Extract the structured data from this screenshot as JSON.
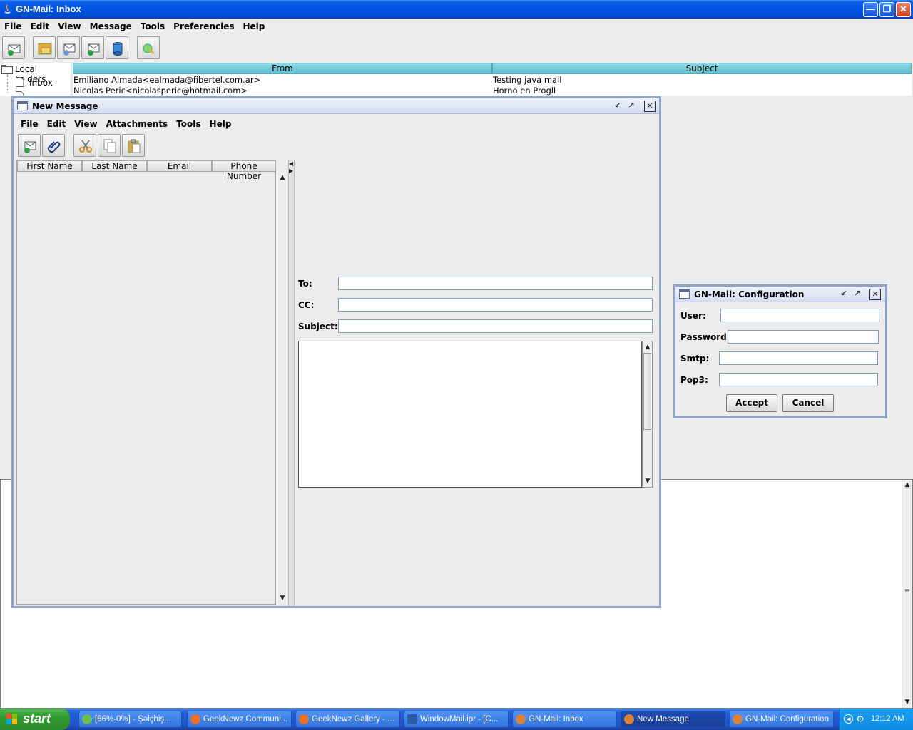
{
  "main_window": {
    "title": "GN-Mail: Inbox",
    "menu": [
      "File",
      "Edit",
      "View",
      "Message",
      "Tools",
      "Preferencies",
      "Help"
    ],
    "folder_tree": {
      "root": "Local Folders",
      "items": [
        "Inbox"
      ]
    },
    "mail_table": {
      "columns": [
        "From",
        "Subject"
      ],
      "rows": [
        {
          "from": "Emiliano Almada<ealmada@fibertel.com.ar>",
          "subject": "Testing java mail"
        },
        {
          "from": "Nicolas Peric<nicolasperic@hotmail.com>",
          "subject": "Horno en Progll"
        }
      ]
    }
  },
  "new_message": {
    "title": "New Message",
    "menu": [
      "File",
      "Edit",
      "View",
      "Attachments",
      "Tools",
      "Help"
    ],
    "contacts_columns": [
      "First Name",
      "Last Name",
      "Email",
      "Phone Number"
    ],
    "to_label": "To:",
    "cc_label": "CC:",
    "subject_label": "Subject:",
    "to_value": "",
    "cc_value": "",
    "subject_value": ""
  },
  "config": {
    "title": "GN-Mail: Configuration",
    "user_label": "User:",
    "password_label": "Password:",
    "smtp_label": "Smtp:",
    "pop3_label": "Pop3:",
    "accept": "Accept",
    "cancel": "Cancel"
  },
  "taskbar": {
    "start": "start",
    "tasks": [
      "[66%-0%] - Şəlçhiş...",
      "GeekNewz Communi...",
      "GeekNewz Gallery - ...",
      "WindowMail.ipr - [C...",
      "GN-Mail: Inbox",
      "New Message",
      "GN-Mail: Configuration"
    ],
    "clock": "12:12 AM"
  },
  "colors": {
    "xp_title_blue": "#0054e3",
    "table_header_teal": "#6ec9d6",
    "frame_border": "#8ea4c8",
    "start_green": "#3a9e3a"
  }
}
